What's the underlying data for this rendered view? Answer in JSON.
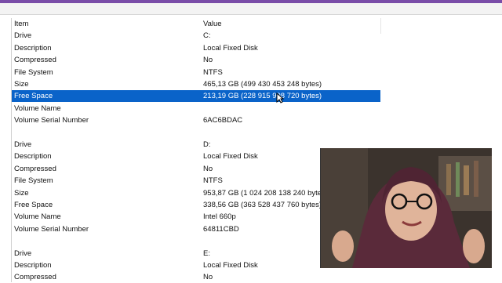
{
  "columns": {
    "item": "Item",
    "value": "Value"
  },
  "rows": [
    {
      "item": "Drive",
      "value": "C:"
    },
    {
      "item": "Description",
      "value": "Local Fixed Disk"
    },
    {
      "item": "Compressed",
      "value": "No"
    },
    {
      "item": "File System",
      "value": "NTFS"
    },
    {
      "item": "Size",
      "value": "465,13 GB (499 430 453 248 bytes)"
    },
    {
      "item": "Free Space",
      "value": "213,19 GB (228 915 998 720 bytes)",
      "selected": true
    },
    {
      "item": "Volume Name",
      "value": ""
    },
    {
      "item": "Volume Serial Number",
      "value": "6AC6BDAC"
    },
    {
      "item": "",
      "value": ""
    },
    {
      "item": "Drive",
      "value": "D:"
    },
    {
      "item": "Description",
      "value": "Local Fixed Disk"
    },
    {
      "item": "Compressed",
      "value": "No"
    },
    {
      "item": "File System",
      "value": "NTFS"
    },
    {
      "item": "Size",
      "value": "953,87 GB (1 024 208 138 240 bytes"
    },
    {
      "item": "Free Space",
      "value": "338,56 GB (363 528 437 760 bytes)"
    },
    {
      "item": "Volume Name",
      "value": "Intel 660p"
    },
    {
      "item": "Volume Serial Number",
      "value": "64811CBD"
    },
    {
      "item": "",
      "value": ""
    },
    {
      "item": "Drive",
      "value": "E:"
    },
    {
      "item": "Description",
      "value": "Local Fixed Disk"
    },
    {
      "item": "Compressed",
      "value": "No"
    }
  ],
  "colors": {
    "selection": "#0a63c9",
    "accent_bar": "#7a4da8"
  },
  "overlay": {
    "icon": "webcam-presenter-video"
  }
}
